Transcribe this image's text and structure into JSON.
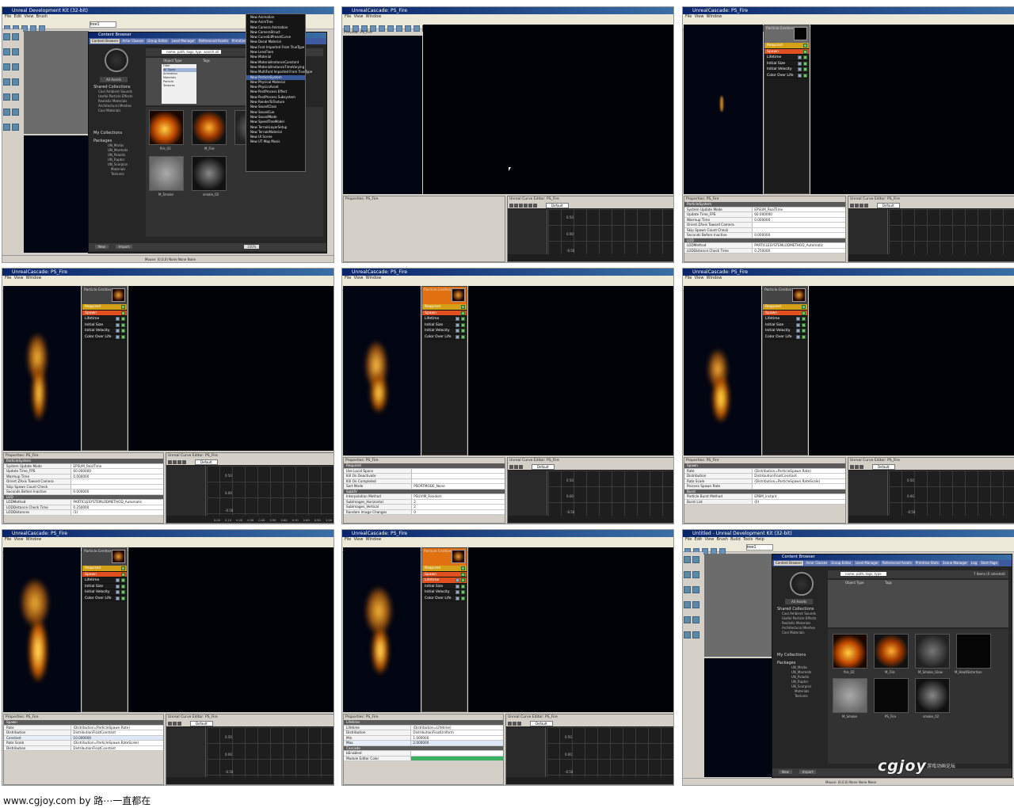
{
  "accent": {
    "title_bar": "#0a246a",
    "required_module": "#d4a017",
    "spawn_module": "#e05020",
    "module_bg": "#1b1b1b",
    "emitter_head": "#e07010"
  },
  "cascade": {
    "window_title": "UnrealCascade: PS_Fire",
    "menu": [
      "File",
      "View",
      "Window"
    ],
    "preview_label": "Preview: PS_Fire",
    "properties_label": "Properties: PS_Fire",
    "curve_label": "Unreal Curve Editor: PS_Fire",
    "emitter_name": "Particle Emitter",
    "curve_preset": "Default",
    "modules": [
      "Required",
      "Spawn",
      "Lifetime",
      "Initial Size",
      "Initial Velocity",
      "Color Over Life"
    ],
    "curve_axis": [
      "0.50",
      "0.00",
      "-0.50"
    ],
    "curve_ticks": [
      "0.00",
      "0.10",
      "0.20",
      "0.30",
      "0.40",
      "0.50",
      "0.60",
      "0.70",
      "0.80",
      "0.90",
      "1.00"
    ]
  },
  "editor": {
    "window_title": "Unreal Development Kit (32-bit)",
    "menu": [
      "File",
      "Edit",
      "View",
      "Brush",
      "Build",
      "Tools",
      "Help"
    ],
    "untitled_title": "Untitled - Unreal Development Kit (32-bit)",
    "status": "Mouse: (0,0,0)   None   None   None",
    "search_box": "tree1"
  },
  "content_browser": {
    "title": "Content Browser",
    "tabs": [
      "Content Browser",
      "Actor Classes",
      "Group Editor",
      "Level Manager",
      "Referenced Assets",
      "Primitive Stats",
      "Scene Manager",
      "Log",
      "Start Page"
    ],
    "all_assets": "All Assets",
    "search_value": "name, path, tags, type",
    "search_option": "search all",
    "object_type_label": "Object Type",
    "tags_label": "Tags",
    "shared_collections": "Shared Collections",
    "shared_items": [
      "Cool Ambient Sounds",
      "Useful Particle Effects",
      "Realistic Materials",
      "Architectural Meshes",
      "Cool Materials"
    ],
    "my_collections": "My Collections",
    "packages": "Packages",
    "package_items": [
      "UN_Marbs",
      "UN_Marmots",
      "UN_Paladin",
      "UN_Raptor",
      "UN_Scorpion",
      "Materials",
      "Textures"
    ],
    "assets": [
      {
        "name": "fire_02",
        "type": "Material"
      },
      {
        "name": "M_Fire",
        "type": "MaterialInstance"
      },
      {
        "name": "M_Smoke",
        "type": "Material"
      },
      {
        "name": "smoke_02",
        "type": "Texture2D"
      },
      {
        "name": "M_Smoke_Glow",
        "type": "Material"
      },
      {
        "name": "PS_Fire",
        "type": "ParticleSystem"
      },
      {
        "name": "M_HeatDistortion",
        "type": "Material"
      }
    ],
    "zoom": "100%",
    "filter_items": [
      "Filter",
      "All Types",
      "Animation",
      "Materials",
      "Particle",
      "Textures"
    ],
    "items_count": "7 Items (0 selected)",
    "buttons": [
      "New",
      "Import",
      "Find"
    ]
  },
  "context_menu": [
    "New Animation",
    "New AnimTree",
    "New Camera Animation",
    "New CameraStruct",
    "New CurveEdPresetCurve",
    "New Decal Material",
    "New Font Imported From TrueType",
    "New LensFlare",
    "New Material",
    "New MaterialInstanceConstant",
    "New MaterialInstanceTimeVarying",
    "New MultiFont Imported From TrueType",
    "New ParticleSystem",
    "New Physical Material",
    "New PhysicsAsset",
    "New PostProcess Effect",
    "New PostProcess Subsystem",
    "New RenderToTexture",
    "New SoundClass",
    "New SoundCue",
    "New SoundMode",
    "New SpeedTreeModel",
    "New TerrainLayerSetup",
    "New TerrainMaterial",
    "New UI Scene",
    "New UT Map Music"
  ],
  "properties": {
    "p2": {
      "header": "ParticleSystem",
      "rows": [
        {
          "k": "System Update Mode",
          "v": "EPSUM_RealTime"
        },
        {
          "k": "Update Time_FPS",
          "v": "60.000000"
        },
        {
          "k": "Warmup Time",
          "v": "0.000000"
        },
        {
          "k": "Orient ZAxis Toward Camera",
          "v": ""
        },
        {
          "k": "Skip Spawn Count Check",
          "v": ""
        },
        {
          "k": "Seconds Before Inactive",
          "v": "0.000000"
        }
      ],
      "header2": "LOD",
      "rows2": [
        {
          "k": "LODMethod",
          "v": "PARTICLESYSTEMLODMETHOD_Automatic"
        },
        {
          "k": "LODDistance Check Time",
          "v": "0.250000"
        },
        {
          "k": "LODDistances",
          "v": "(1)"
        }
      ]
    },
    "p5": {
      "header": "Required",
      "rows": [
        {
          "k": "Use Local Space",
          "v": ""
        },
        {
          "k": "Kill On Deactivate",
          "v": ""
        },
        {
          "k": "Kill On Completed",
          "v": ""
        },
        {
          "k": "Sort Mode",
          "v": "PSORTMODE_None"
        }
      ],
      "header2": "SubUV",
      "rows2": [
        {
          "k": "Interpolation Method",
          "v": "PSUVIM_Random"
        },
        {
          "k": "SubImages_Horizontal",
          "v": "2"
        },
        {
          "k": "SubImages_Vertical",
          "v": "2"
        },
        {
          "k": "Random Image Changes",
          "v": "0"
        }
      ]
    },
    "p6": {
      "header": "Spawn",
      "rows": [
        {
          "k": "Rate",
          "v": "(Distribution=ParticleSpawn.Rate)"
        },
        {
          "k": "Distribution",
          "v": "DistributionFloatConstant"
        },
        {
          "k": "Rate Scale",
          "v": "(Distribution=ParticleSpawn.RateScale)"
        },
        {
          "k": "Process Spawn Rate",
          "v": ""
        }
      ],
      "header2": "Burst",
      "rows2": [
        {
          "k": "Particle Burst Method",
          "v": "EPBM_Instant"
        },
        {
          "k": "Burst List",
          "v": "(0)"
        }
      ]
    },
    "p7": {
      "header": "Spawn",
      "rows": [
        {
          "k": "Rate",
          "v": "(Distribution=ParticleSpawn.Rate)"
        },
        {
          "k": "Distribution",
          "v": "DistributionFloatConstant"
        },
        {
          "k": "Constant",
          "v": "10.000000"
        },
        {
          "k": "Rate Scale",
          "v": "(Distribution=ParticleSpawn.RateScale)"
        },
        {
          "k": "Distribution",
          "v": "DistributionFloatConstant"
        }
      ]
    },
    "p8": {
      "header": "Lifetime",
      "rows": [
        {
          "k": "Lifetime",
          "v": "(Distribution=Lifetime)"
        },
        {
          "k": "Distribution",
          "v": "DistributionFloatUniform"
        },
        {
          "k": "Min",
          "v": "1.000000"
        },
        {
          "k": "Max",
          "v": "2.000000"
        }
      ],
      "header2": "Cascade",
      "rows2": [
        {
          "k": "bEnabled",
          "v": ""
        },
        {
          "k": "Module Editor Color",
          "v": ""
        }
      ]
    }
  },
  "footer": {
    "credit": "www.cgjoy.com by 路⋯一直都在",
    "watermark": "cgjoy",
    "watermark_sub": "游戏动画论坛"
  }
}
